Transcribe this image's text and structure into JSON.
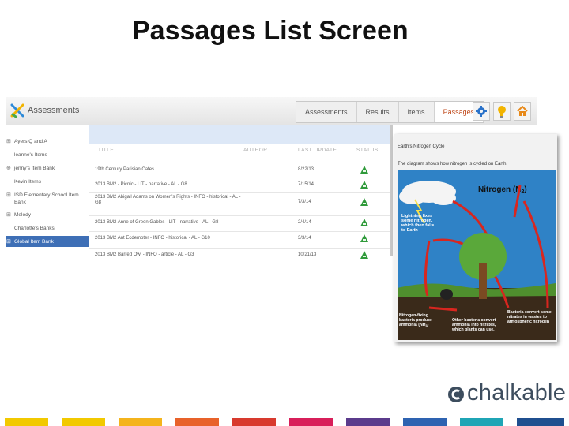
{
  "slide": {
    "title": "Passages List Screen"
  },
  "app": {
    "name": "Assessments"
  },
  "tabs": [
    {
      "label": "Assessments"
    },
    {
      "label": "Results"
    },
    {
      "label": "Items"
    },
    {
      "label": "Passages",
      "active": true
    }
  ],
  "toolbar_icons": [
    "gear-icon",
    "lightbulb-icon",
    "home-icon"
  ],
  "sidebar": {
    "items": [
      {
        "expander": "⊞",
        "label": "Ayers Q and A"
      },
      {
        "expander": "",
        "label": "leanne's Items"
      },
      {
        "expander": "⊕",
        "label": "jenny's Item Bank"
      },
      {
        "expander": "",
        "label": "Kevin Items"
      },
      {
        "expander": "⊞",
        "label": "ISD Elementary School Item Bank"
      },
      {
        "expander": "⊞",
        "label": "Melody"
      },
      {
        "expander": "",
        "label": "Charlotte's Banks"
      },
      {
        "expander": "⊞",
        "label": "Global Item Bank",
        "selected": true
      }
    ]
  },
  "table": {
    "headers": {
      "title": "TITLE",
      "author": "AUTHOR",
      "last_update": "LAST UPDATE",
      "status": "STATUS"
    },
    "rows": [
      {
        "title": "19th Century Parisian Cafes",
        "date": "8/22/13",
        "status_icon": "approved-icon"
      },
      {
        "title": "2013 BM2 - Picnic - LIT - narrative - AL - G8",
        "date": "7/15/14",
        "status_icon": "approved-icon"
      },
      {
        "title": "2013 BM2 Abigail Adams on Women's Rights - INFO - historical - AL - G8",
        "date": "7/3/14",
        "status_icon": "approved-icon"
      },
      {
        "title": "2013 BM2 Anne of Green Gables - LIT - narrative - AL - G8",
        "date": "2/4/14",
        "status_icon": "approved-icon"
      },
      {
        "title": "2013 BM2 Ant Ecdemoter - INFO - historical - AL - G10",
        "date": "3/3/14",
        "status_icon": "approved-icon"
      },
      {
        "title": "2013 BM2 Barred Owl - INFO - article - AL - G3",
        "date": "10/21/13",
        "status_icon": "approved-icon"
      }
    ]
  },
  "popup": {
    "title": "Earth's Nitrogen Cycle",
    "description": "The diagram shows how nitrogen is cycled on Earth.",
    "diagram": {
      "nitrogen_label": "Nitrogen (N",
      "nitrogen_sub": "2",
      "nitrogen_close": ")",
      "lightning_lines": [
        "Lightning fixes",
        "some nitrogen,",
        "which then falls",
        "to Earth"
      ],
      "bacteria_right_lines": [
        "Bacteria convert some",
        "nitrates in wastes to",
        "atmospheric nitrogen"
      ],
      "fixing_lines": [
        "Nitrogen-fixing",
        "bacteria produce",
        "ammonia (NH"
      ],
      "fixing_sub": "3",
      "fixing_close": ")",
      "other_lines": [
        "Other bacteria convert",
        "ammonia into nitrates,",
        "which plants can use."
      ]
    }
  },
  "footer": {
    "logo_text": "chalkable"
  },
  "colors": {
    "accent": "#c04a1c",
    "selected": "#3e6fb6",
    "strip": [
      "#f2c900",
      "#f2c900",
      "#f2c900",
      "#f4a21c",
      "#e8622a",
      "#d83a2e",
      "#d81f5a",
      "#5b3b8c",
      "#2e63b1",
      "#1fa5b5",
      "#1f4f8f"
    ]
  }
}
